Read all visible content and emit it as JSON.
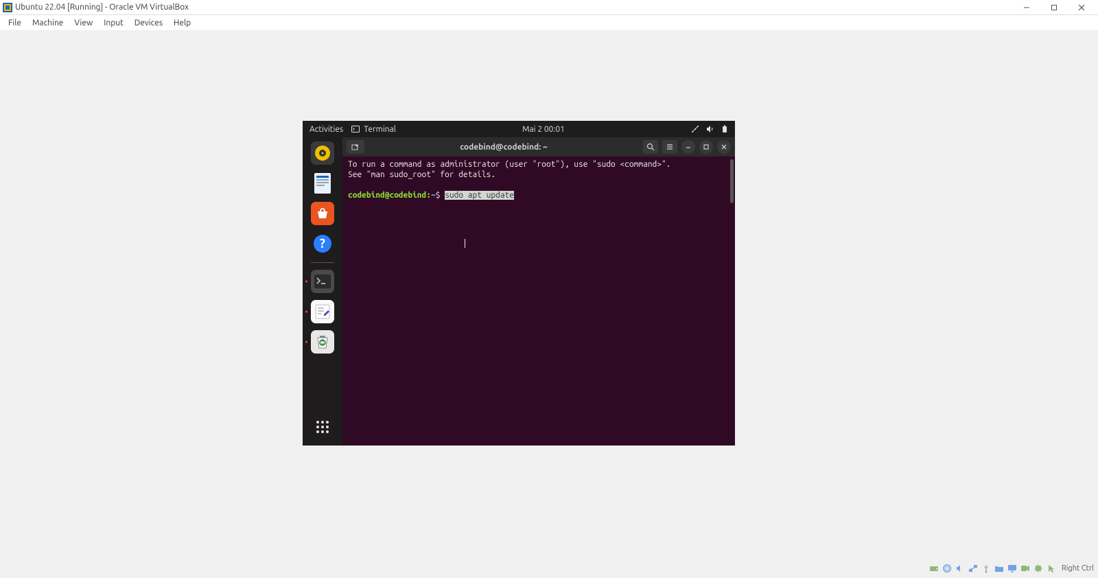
{
  "host_window": {
    "title": "Ubuntu 22.04 [Running] - Oracle VM VirtualBox",
    "menus": [
      "File",
      "Machine",
      "View",
      "Input",
      "Devices",
      "Help"
    ]
  },
  "ubuntu": {
    "topbar": {
      "activities": "Activities",
      "app_label": "Terminal",
      "clock": "Mai 2  00:01"
    },
    "dock": {
      "items": [
        {
          "name": "rhythmbox"
        },
        {
          "name": "libreoffice-writer"
        },
        {
          "name": "software-center"
        },
        {
          "name": "help"
        }
      ]
    },
    "terminal": {
      "title": "codebind@codebind: ~",
      "output_line1": "To run a command as administrator (user \"root\"), use \"sudo <command>\".",
      "output_line2": "See \"man sudo_root\" for details.",
      "prompt_user": "codebind@codebind",
      "prompt_path": "~",
      "prompt_dollar": "$",
      "command": "sudo apt update"
    }
  },
  "statusbar": {
    "host_key": "Right Ctrl"
  }
}
